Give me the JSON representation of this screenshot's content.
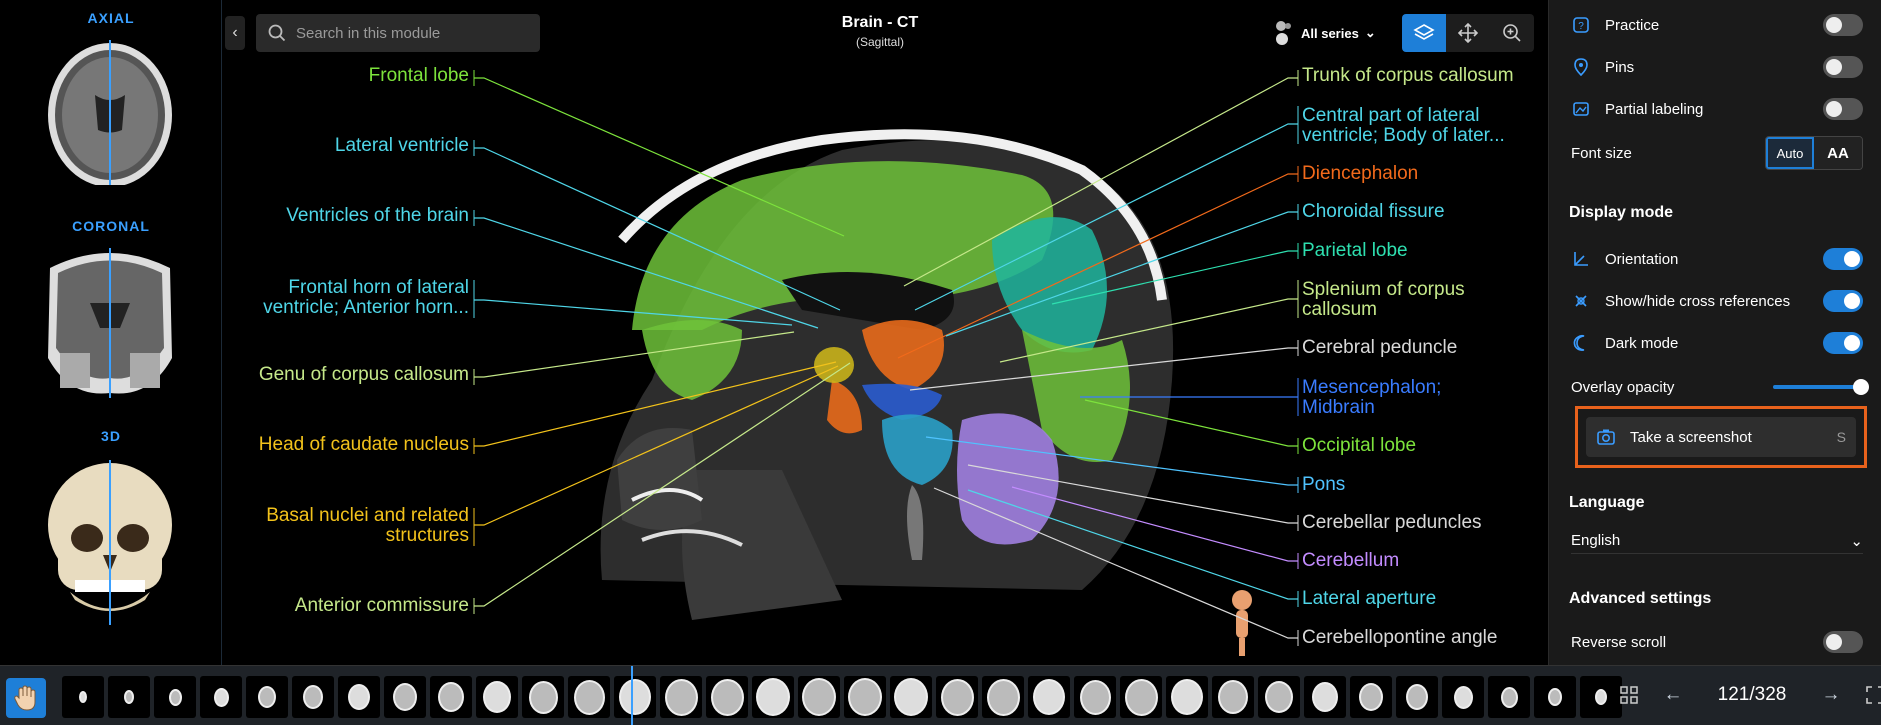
{
  "left_views": {
    "axial": "AXIAL",
    "coronal": "CORONAL",
    "threed": "3D"
  },
  "header": {
    "search_placeholder": "Search in this module",
    "title": "Brain - CT",
    "subtitle": "(Sagittal)",
    "series_label": "All series"
  },
  "labels_left": [
    {
      "text": "Frontal lobe",
      "color": "#7de33c"
    },
    {
      "text": "Lateral ventricle",
      "color": "#4fd6e8"
    },
    {
      "text": "Ventricles of the brain",
      "color": "#4fd6e8"
    },
    {
      "text": "Frontal horn of lateral",
      "text2": "ventricle; Anterior horn...",
      "color": "#4fd6e8"
    },
    {
      "text": "Genu of corpus callosum",
      "color": "#c5e88a"
    },
    {
      "text": "Head of caudate nucleus",
      "color": "#f2c21b"
    },
    {
      "text": "Basal nuclei and related",
      "text2": "structures",
      "color": "#f2c21b"
    },
    {
      "text": "Anterior commissure",
      "color": "#c5e88a"
    }
  ],
  "labels_right": [
    {
      "text": "Trunk of corpus callosum",
      "color": "#c5e88a"
    },
    {
      "text": "Central part of lateral",
      "text2": "ventricle; Body of later...",
      "color": "#4fd6e8"
    },
    {
      "text": "Diencephalon",
      "color": "#f26a1b"
    },
    {
      "text": "Choroidal fissure",
      "color": "#4fd6e8"
    },
    {
      "text": "Parietal lobe",
      "color": "#2ee0b0"
    },
    {
      "text": "Splenium of corpus",
      "text2": "callosum",
      "color": "#c5e88a"
    },
    {
      "text": "Cerebral peduncle",
      "color": "#d9d9d9"
    },
    {
      "text": "Mesencephalon;",
      "text2": "Midbrain",
      "color": "#3a7cff"
    },
    {
      "text": "Occipital lobe",
      "color": "#7de33c"
    },
    {
      "text": "Pons",
      "color": "#4fc3ff"
    },
    {
      "text": "Cerebellar peduncles",
      "color": "#d9d9d9"
    },
    {
      "text": "Cerebellum",
      "color": "#c38cff"
    },
    {
      "text": "Lateral aperture",
      "color": "#4fd6e8"
    },
    {
      "text": "Cerebellopontine angle",
      "color": "#d9d9d9"
    }
  ],
  "panel": {
    "practice": "Practice",
    "pins": "Pins",
    "partial_labeling": "Partial labeling",
    "font_size": "Font size",
    "font_auto": "Auto",
    "font_aa": "AA",
    "display_mode": "Display mode",
    "orientation": "Orientation",
    "cross_refs": "Show/hide cross references",
    "dark_mode": "Dark mode",
    "overlay_opacity": "Overlay opacity",
    "screenshot": "Take a screenshot",
    "screenshot_key": "S",
    "language_heading": "Language",
    "language": "English",
    "advanced": "Advanced settings",
    "reverse_scroll": "Reverse scroll",
    "toggles": {
      "practice": false,
      "pins": false,
      "partial_labeling": false,
      "orientation": true,
      "cross_refs": true,
      "dark_mode": true,
      "reverse_scroll": false
    },
    "overlay_opacity_value": 1.0
  },
  "pager": {
    "current": "121/328"
  },
  "colors": {
    "accent": "#1e7fd8",
    "highlight": "#e8621c"
  }
}
